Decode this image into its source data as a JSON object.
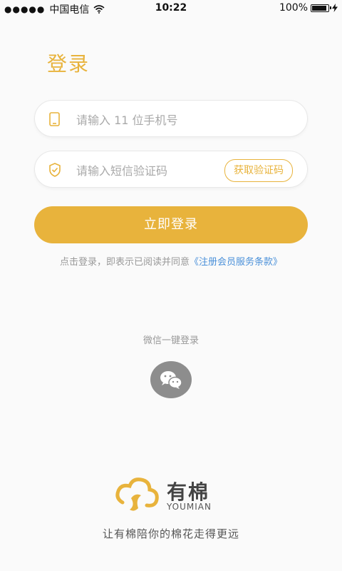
{
  "status_bar": {
    "signal": "●●●●●",
    "carrier": "中国电信",
    "time": "10:22",
    "battery": "100%"
  },
  "page": {
    "title": "登录"
  },
  "form": {
    "phone_placeholder": "请输入 11 位手机号",
    "code_placeholder": "请输入短信验证码",
    "get_code_label": "获取验证码",
    "submit_label": "立即登录"
  },
  "terms": {
    "prefix": "点击登录，即表示已阅读并同意",
    "link": "《注册会员服务条款》"
  },
  "wechat": {
    "label": "微信一键登录"
  },
  "brand": {
    "name": "有棉",
    "english": "YOUMIAN",
    "slogan": "让有棉陪你的棉花走得更远"
  },
  "colors": {
    "accent": "#e8b33c",
    "link": "#4a90d9",
    "wechat_bg": "#8d8d8d"
  },
  "icons": {
    "phone": "phone-icon",
    "code": "shield-check-icon",
    "wechat": "wechat-icon",
    "wifi": "wifi-icon",
    "battery": "battery-icon",
    "charging": "charging-icon"
  }
}
